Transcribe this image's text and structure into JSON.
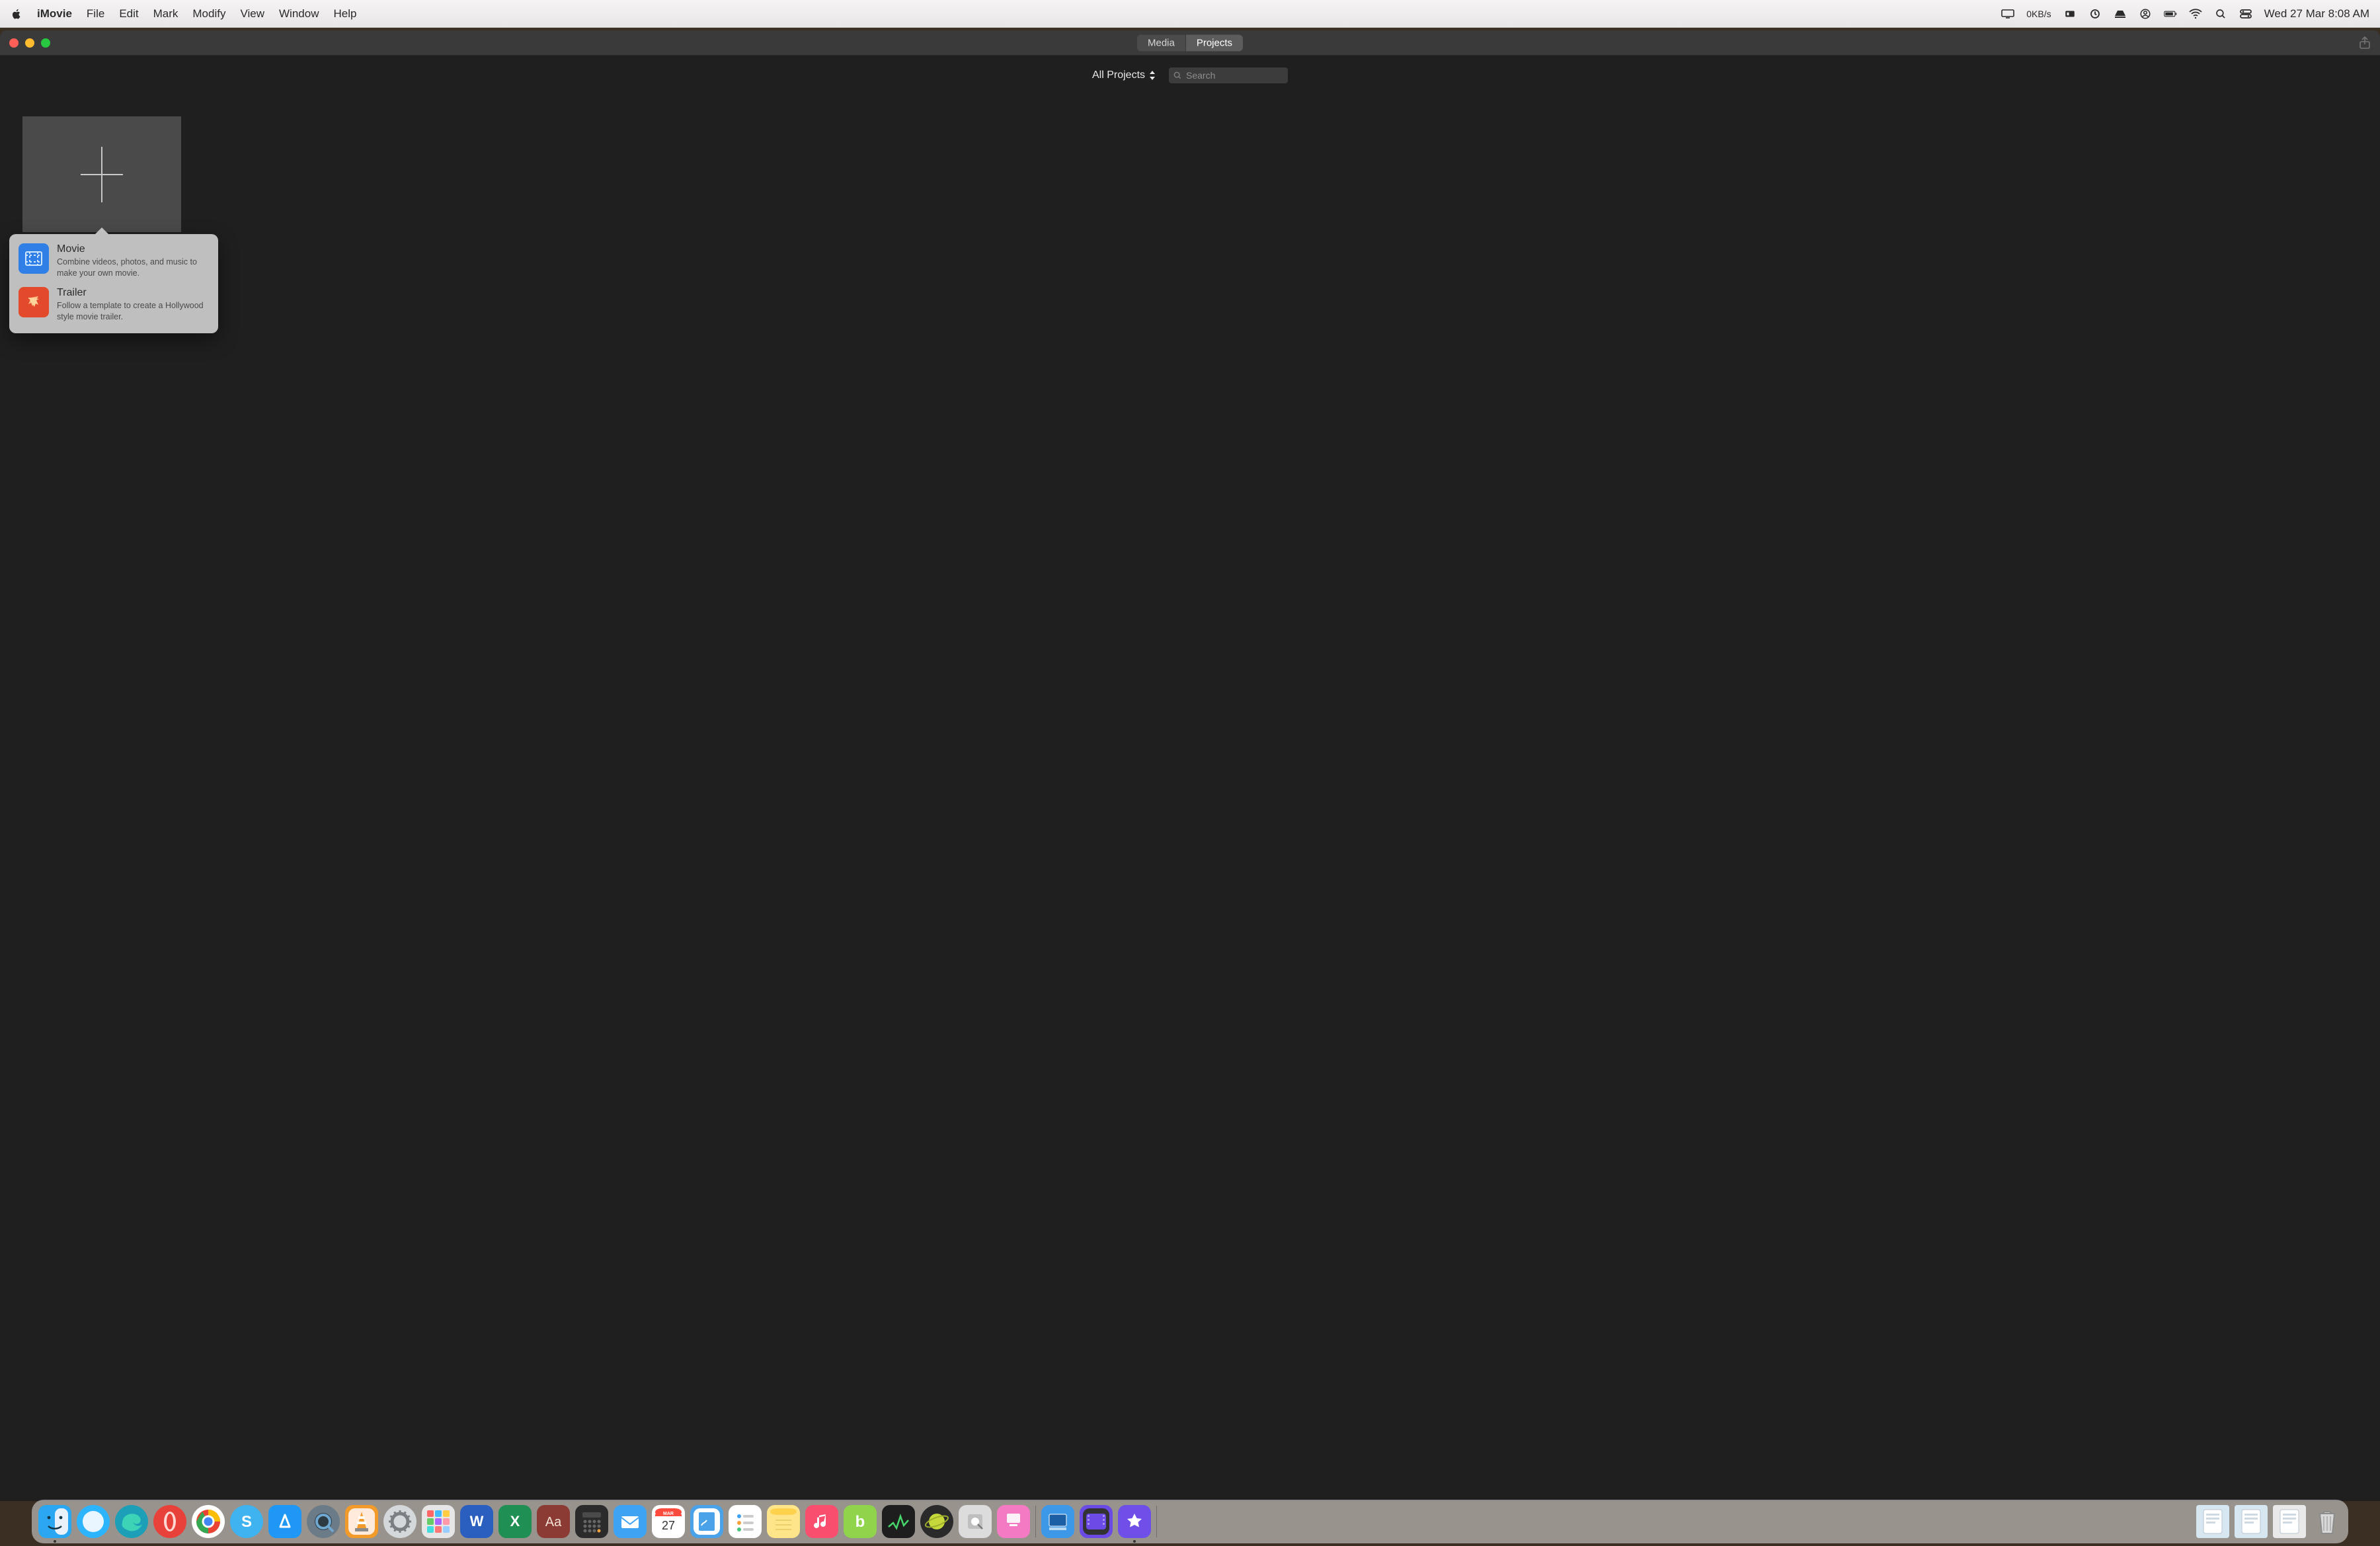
{
  "menubar": {
    "app": "iMovie",
    "items": [
      "File",
      "Edit",
      "Mark",
      "Modify",
      "View",
      "Window",
      "Help"
    ],
    "net_rate": "0KB/s",
    "datetime": "Wed 27 Mar  8:08 AM"
  },
  "window": {
    "tabs": {
      "media": "Media",
      "projects": "Projects",
      "active": "projects"
    },
    "projects_dropdown": "All Projects",
    "search_placeholder": "Search"
  },
  "popover": {
    "movie": {
      "title": "Movie",
      "sub": "Combine videos, photos, and music to make your own movie."
    },
    "trailer": {
      "title": "Trailer",
      "sub": "Follow a template to create a Hollywood style movie trailer."
    }
  },
  "calendar_tile": {
    "month": "MAR",
    "day": "27"
  },
  "dock": {
    "apps": [
      {
        "name": "finder",
        "bg": "#2aa7f0",
        "running": true
      },
      {
        "name": "safari",
        "bg": "#2db4ff",
        "round": true,
        "running": false
      },
      {
        "name": "edge",
        "bg": "#1c9fb7",
        "round": true,
        "running": false
      },
      {
        "name": "opera",
        "bg": "#e8413a",
        "round": true,
        "running": false
      },
      {
        "name": "chrome",
        "bg": "#ffffff",
        "round": true,
        "running": false
      },
      {
        "name": "skype",
        "bg": "#3fb3ef",
        "round": true,
        "running": false
      },
      {
        "name": "appstore",
        "bg": "#1f97f4",
        "running": false
      },
      {
        "name": "quicktime",
        "bg": "#6b7c88",
        "round": true,
        "running": false
      },
      {
        "name": "vlc",
        "bg": "#f39b2a",
        "running": false
      },
      {
        "name": "settings",
        "bg": "#d5d8db",
        "round": true,
        "running": false
      },
      {
        "name": "launchpad",
        "bg": "#e6e6e6",
        "running": false
      },
      {
        "name": "word",
        "bg": "#2a5fbf",
        "running": false
      },
      {
        "name": "excel",
        "bg": "#1f8f54",
        "running": false
      },
      {
        "name": "dictionary",
        "bg": "#8c3a34",
        "running": false
      },
      {
        "name": "calculator",
        "bg": "#2b2b2b",
        "running": false
      },
      {
        "name": "mail",
        "bg": "#3fa3f3",
        "running": false
      },
      {
        "name": "calendar",
        "bg": "#ffffff",
        "running": false
      },
      {
        "name": "pages",
        "bg": "#4aa2e8",
        "running": false
      },
      {
        "name": "reminders",
        "bg": "#ffffff",
        "running": false
      },
      {
        "name": "notes",
        "bg": "#ffe58a",
        "running": false
      },
      {
        "name": "music",
        "bg": "#fa4e6f",
        "running": false
      },
      {
        "name": "beeper",
        "bg": "#8fd44a",
        "running": false
      },
      {
        "name": "activity",
        "bg": "#1e1e1e",
        "running": false
      },
      {
        "name": "planet",
        "bg": "#2a2a2a",
        "round": true,
        "running": false
      },
      {
        "name": "diskutil",
        "bg": "#dcdcdc",
        "running": false
      },
      {
        "name": "cleanmymac",
        "bg": "#f47bc3",
        "running": false
      }
    ],
    "apps_right": [
      {
        "name": "screenflow",
        "bg": "#3d98e8",
        "running": false
      },
      {
        "name": "fcpx",
        "bg": "#6b4ae6",
        "running": false
      },
      {
        "name": "imovie",
        "bg": "#6f4fe8",
        "running": true
      }
    ],
    "docs": [
      {
        "name": "doc1",
        "bg": "#d7e7f2"
      },
      {
        "name": "doc2",
        "bg": "#d7e7f2"
      },
      {
        "name": "doc3",
        "bg": "#e9e9e9"
      }
    ]
  }
}
